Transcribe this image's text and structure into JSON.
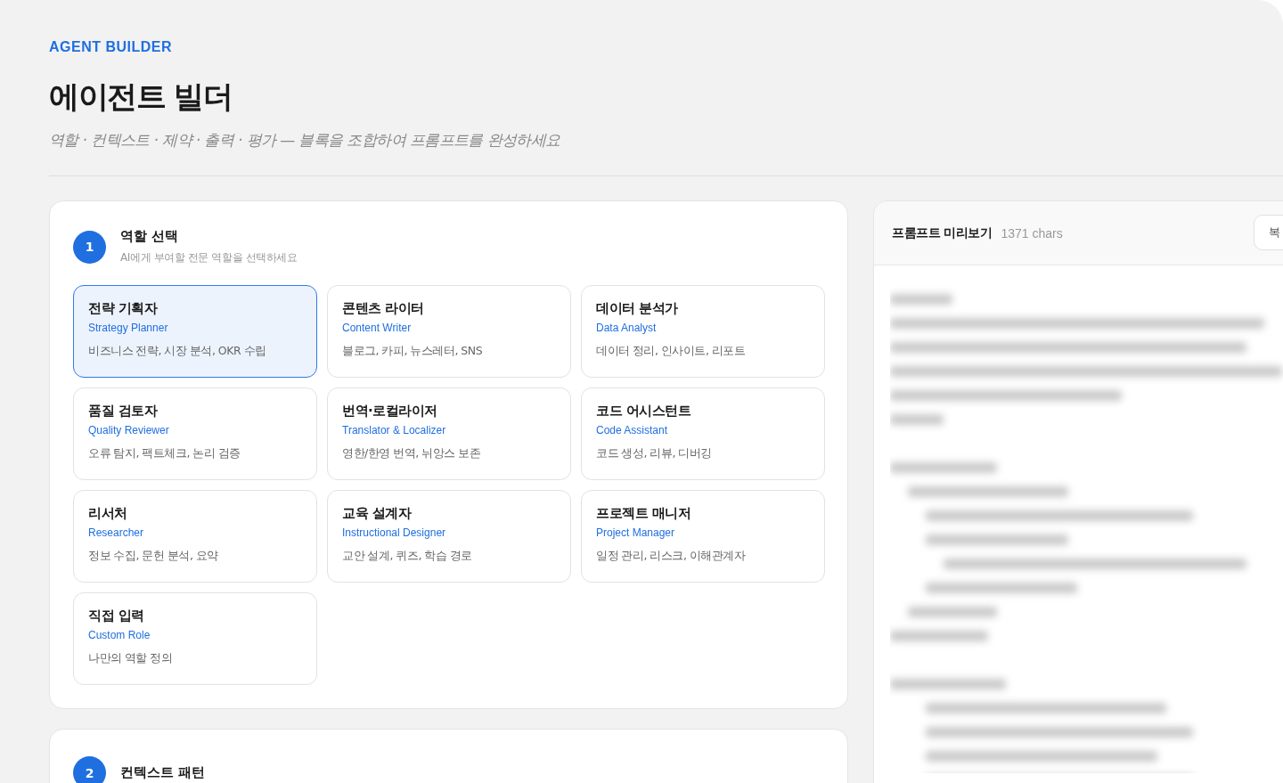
{
  "header": {
    "eyebrow": "AGENT BUILDER",
    "title": "에이전트 빌더",
    "subtitle": "역할 · 컨텍스트 · 제약 · 출력 · 평가 — 블록을 조합하여 프롬프트를 완성하세요"
  },
  "steps": [
    {
      "number": "1",
      "title": "역할 선택",
      "description": "AI에게 부여할 전문 역할을 선택하세요",
      "roles": [
        {
          "name": "전략 기획자",
          "english": "Strategy Planner",
          "summary": "비즈니스 전략, 시장 분석, OKR 수립",
          "selected": true
        },
        {
          "name": "콘텐츠 라이터",
          "english": "Content Writer",
          "summary": "블로그, 카피, 뉴스레터, SNS",
          "selected": false
        },
        {
          "name": "데이터 분석가",
          "english": "Data Analyst",
          "summary": "데이터 정리, 인사이트, 리포트",
          "selected": false
        },
        {
          "name": "품질 검토자",
          "english": "Quality Reviewer",
          "summary": "오류 탐지, 팩트체크, 논리 검증",
          "selected": false
        },
        {
          "name": "번역·로컬라이저",
          "english": "Translator & Localizer",
          "summary": "영한/한영 번역, 뉘앙스 보존",
          "selected": false
        },
        {
          "name": "코드 어시스턴트",
          "english": "Code Assistant",
          "summary": "코드 생성, 리뷰, 디버깅",
          "selected": false
        },
        {
          "name": "리서처",
          "english": "Researcher",
          "summary": "정보 수집, 문헌 분석, 요약",
          "selected": false
        },
        {
          "name": "교육 설계자",
          "english": "Instructional Designer",
          "summary": "교안 설계, 퀴즈, 학습 경로",
          "selected": false
        },
        {
          "name": "프로젝트 매니저",
          "english": "Project Manager",
          "summary": "일정 관리, 리스크, 이해관계자",
          "selected": false
        },
        {
          "name": "직접 입력",
          "english": "Custom Role",
          "summary": "나만의 역할 정의",
          "selected": false
        }
      ]
    },
    {
      "number": "2",
      "title": "컨텍스트 패턴"
    }
  ],
  "preview": {
    "title": "프롬프트 미리보기",
    "count": "1371 chars",
    "copy_button": "복"
  }
}
